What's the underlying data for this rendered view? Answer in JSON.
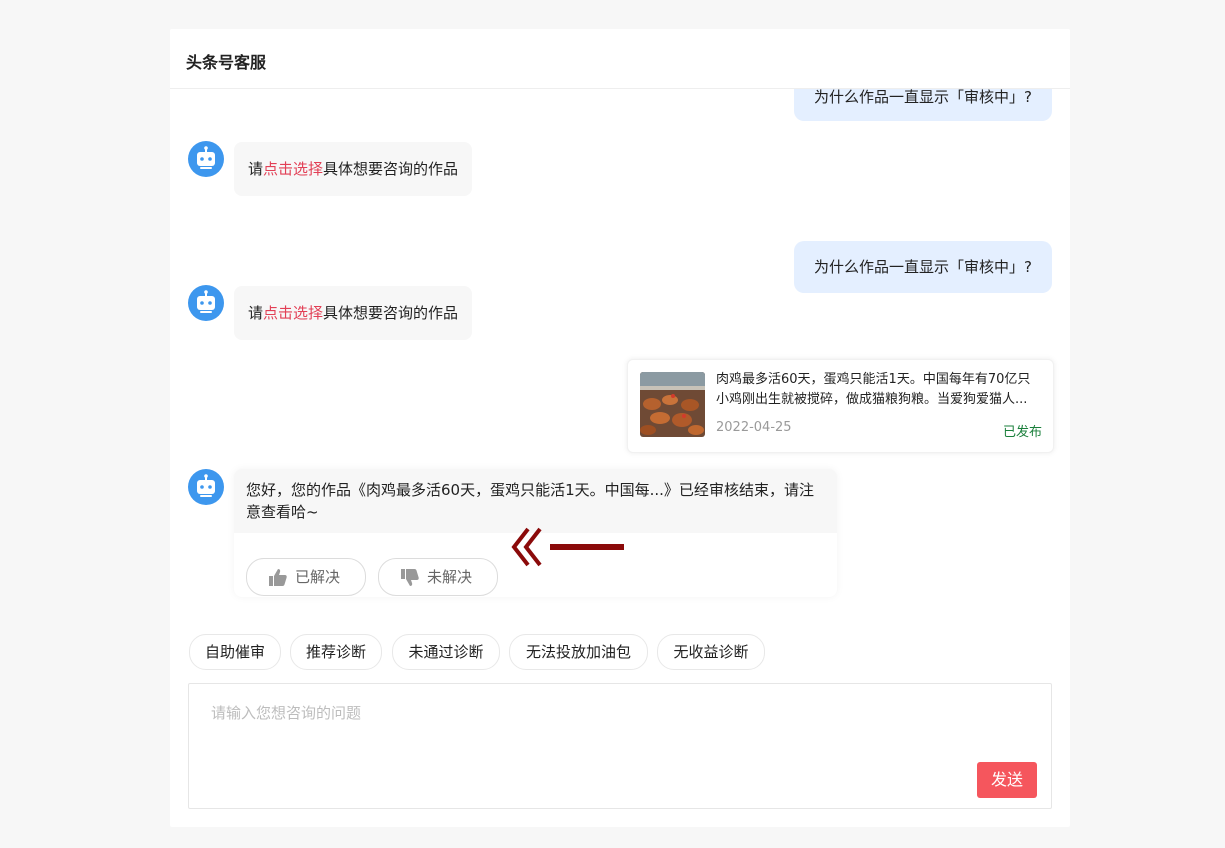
{
  "header": {
    "title": "头条号客服"
  },
  "messages": {
    "user_question": "为什么作品一直显示「审核中」?",
    "bot_prompt_prefix": "请",
    "bot_prompt_link": "点击选择",
    "bot_prompt_suffix": "具体想要咨询的作品"
  },
  "work_card": {
    "line1": "肉鸡最多活60天，蛋鸡只能活1天。中国每年有70亿只",
    "line2": "小鸡刚出生就被搅碎，做成猫粮狗粮。当爱狗爱猫人...",
    "date": "2022-04-25",
    "status": "已发布"
  },
  "bot_reply": {
    "text": "您好，您的作品《肉鸡最多活60天，蛋鸡只能活1天。中国每...》已经审核结束，请注意查看哈~",
    "resolved_label": "已解决",
    "unresolved_label": "未解决"
  },
  "quick_actions": [
    "自助催审",
    "推荐诊断",
    "未通过诊断",
    "无法投放加油包",
    "无收益诊断"
  ],
  "input": {
    "placeholder": "请输入您想咨询的问题",
    "send_label": "发送"
  },
  "colors": {
    "accent_red": "#e23f55",
    "send_button": "#f5565d",
    "user_bubble": "#e4efff",
    "bot_avatar": "#3d97ee",
    "published_status": "#1a7f3b",
    "annotation_arrow": "#8b0a0a"
  }
}
